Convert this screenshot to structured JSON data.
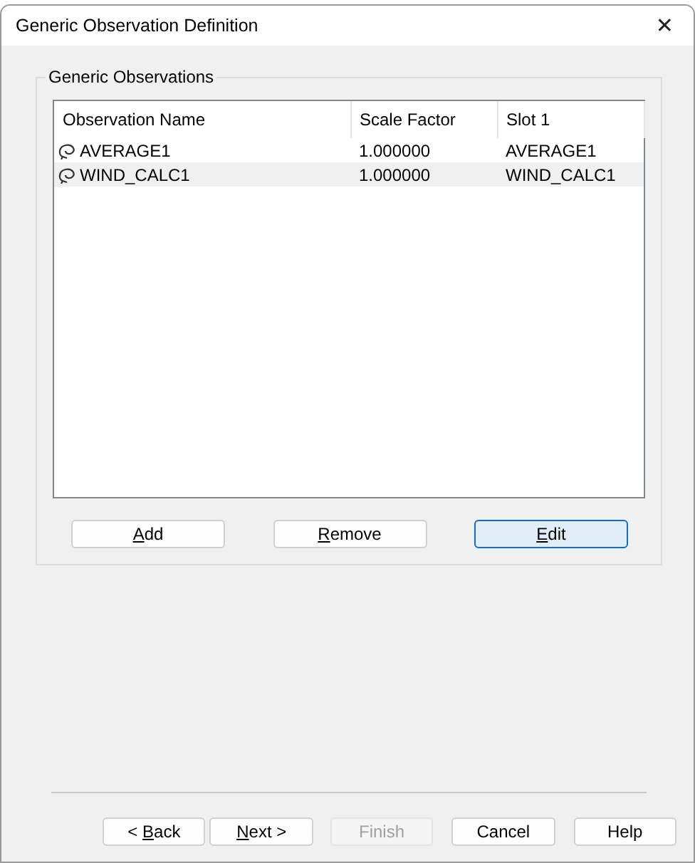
{
  "window": {
    "title": "Generic Observation Definition",
    "close": "✕"
  },
  "group": {
    "title": "Generic Observations"
  },
  "table": {
    "columns": [
      "Observation Name",
      "Scale Factor",
      "Slot 1"
    ],
    "rows": [
      {
        "cells": [
          "AVERAGE1",
          "1.000000",
          "AVERAGE1"
        ],
        "selected": false
      },
      {
        "cells": [
          "WIND_CALC1",
          "1.000000",
          "WIND_CALC1"
        ],
        "selected": true
      }
    ]
  },
  "list_buttons": [
    {
      "key": "A",
      "after": "dd",
      "default": false,
      "disabled": false
    },
    {
      "key": "R",
      "after": "emove",
      "default": false,
      "disabled": false
    },
    {
      "key": "E",
      "after": "dit",
      "default": true,
      "disabled": false
    }
  ],
  "wizard_buttons": [
    {
      "before": "< ",
      "key": "B",
      "after": "ack",
      "default": false,
      "disabled": false
    },
    {
      "key": "N",
      "after": "ext >",
      "default": false,
      "disabled": false
    },
    {
      "before": "Finish",
      "default": false,
      "disabled": true
    },
    {
      "before": "Cancel",
      "default": false,
      "disabled": false
    },
    {
      "before": "Help",
      "default": false,
      "disabled": false
    }
  ]
}
